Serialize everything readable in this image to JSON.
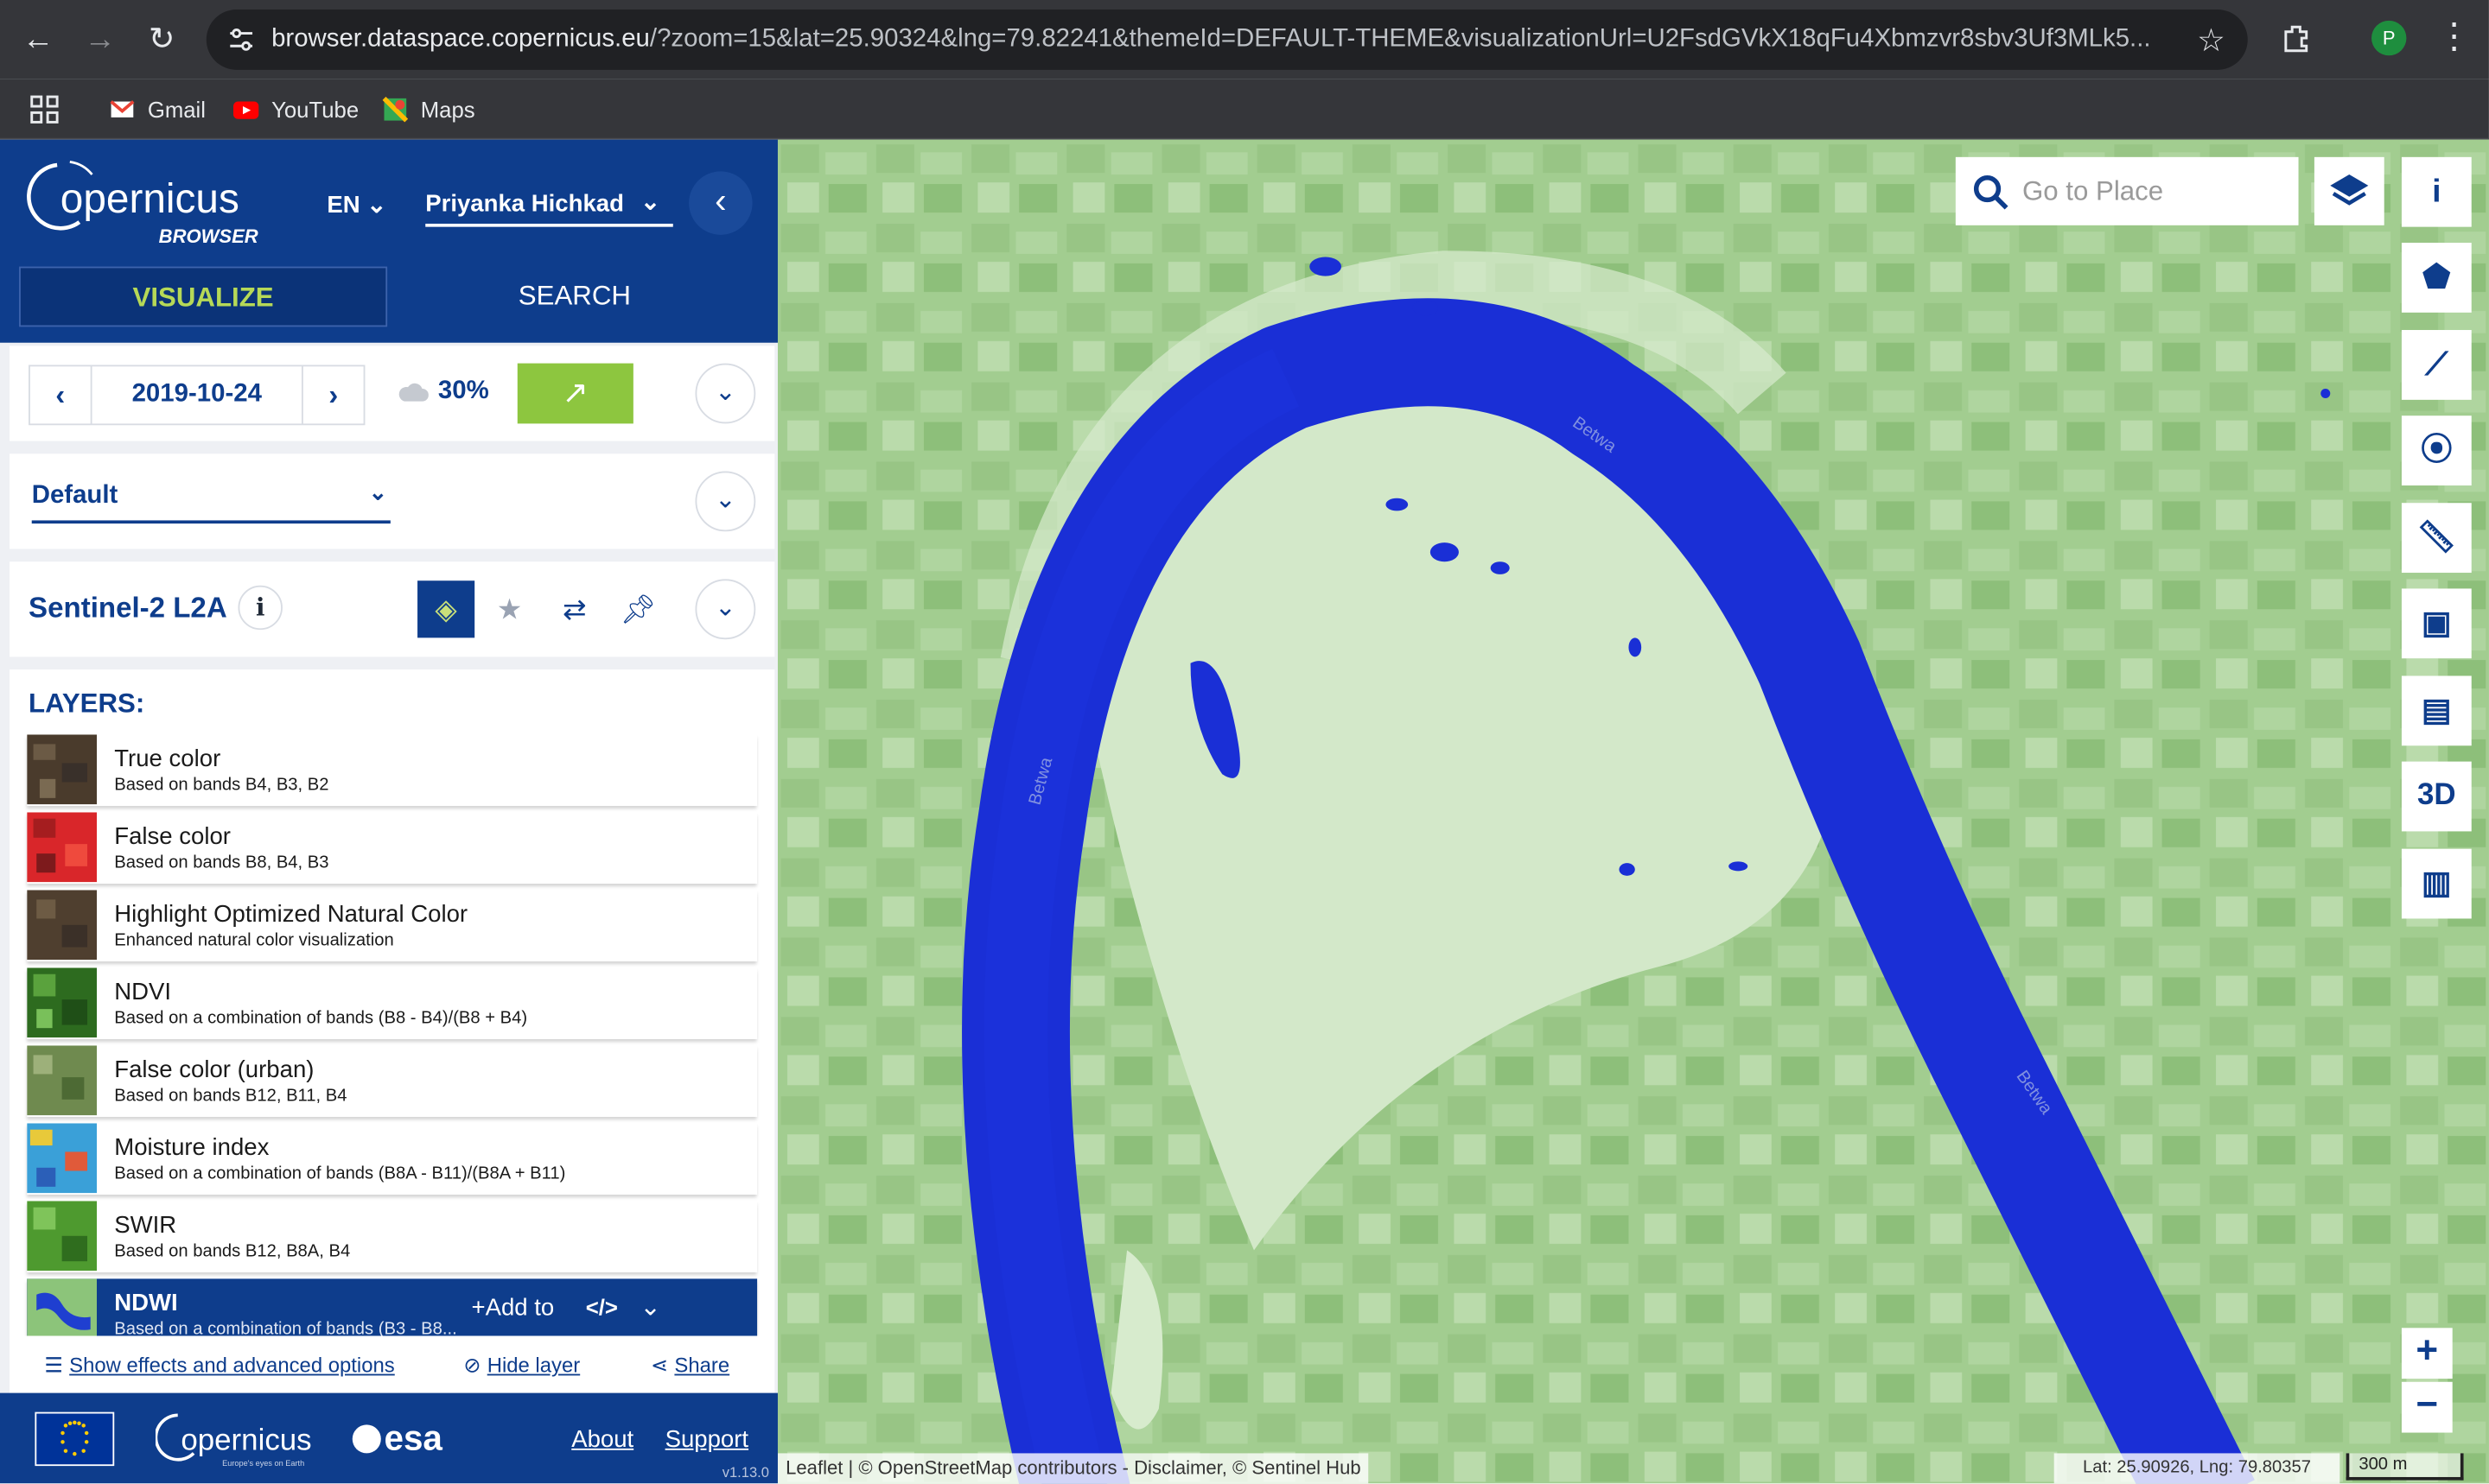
{
  "browser": {
    "url_host": "browser.dataspace.copernicus.eu",
    "url_rest": "/?zoom=15&lat=25.90324&lng=79.82241&themeId=DEFAULT-THEME&visualizationUrl=U2FsdGVkX18qFu4Xbmzvr8sbv3Uf3MLk5...",
    "profile_initial": "P",
    "bookmarks": [
      {
        "label": "Gmail",
        "icon": "gmail-icon"
      },
      {
        "label": "YouTube",
        "icon": "youtube-icon"
      },
      {
        "label": "Maps",
        "icon": "maps-icon"
      }
    ]
  },
  "header": {
    "logo_text": "opernicus",
    "logo_sub": "BROWSER",
    "language": "EN",
    "user_name": "Priyanka Hichkad",
    "tabs": [
      "VISUALIZE",
      "SEARCH"
    ]
  },
  "date_panel": {
    "date": "2019-10-24",
    "cloud_coverage": "30%"
  },
  "theme": {
    "selected": "Default"
  },
  "dataset": {
    "name": "Sentinel-2 L2A"
  },
  "layers": {
    "heading": "LAYERS:",
    "items": [
      {
        "name": "True color",
        "desc": "Based on bands B4, B3, B2"
      },
      {
        "name": "False color",
        "desc": "Based on bands B8, B4, B3"
      },
      {
        "name": "Highlight Optimized Natural Color",
        "desc": "Enhanced natural color visualization"
      },
      {
        "name": "NDVI",
        "desc": "Based on a combination of bands (B8 - B4)/(B8 + B4)"
      },
      {
        "name": "False color (urban)",
        "desc": "Based on bands B12, B11, B4"
      },
      {
        "name": "Moisture index",
        "desc": "Based on a combination of bands (B8A - B11)/(B8A + B11)"
      },
      {
        "name": "SWIR",
        "desc": "Based on bands B12, B8A, B4"
      }
    ],
    "selected": {
      "name": "NDWI",
      "desc": "Based on a combination of bands (B3 - B8...",
      "add_to": "Add to",
      "embed": "</>"
    }
  },
  "actions": {
    "effects": "Show effects and advanced options",
    "hide": "Hide layer",
    "share": "Share"
  },
  "footer": {
    "esa": "esa",
    "flogo_text": "opernicus",
    "flogo_sub": "Europe's eyes on Earth",
    "about": "About",
    "support": "Support",
    "version": "v1.13.0"
  },
  "map": {
    "search_placeholder": "Go to Place",
    "tool_3d": "3D",
    "river_label": "Betwa",
    "attribution": "Leaflet | © OpenStreetMap contributors - Disclaimer, © Sentinel Hub",
    "coords": "Lat: 25.90926, Lng: 79.80357",
    "scale": "300 m",
    "zoom_in": "+",
    "zoom_out": "−"
  },
  "colors": {
    "brand_blue": "#0e3d8c",
    "accent_green": "#8dc63f",
    "water": "#1a2fd6",
    "land": "#a7cf95"
  }
}
